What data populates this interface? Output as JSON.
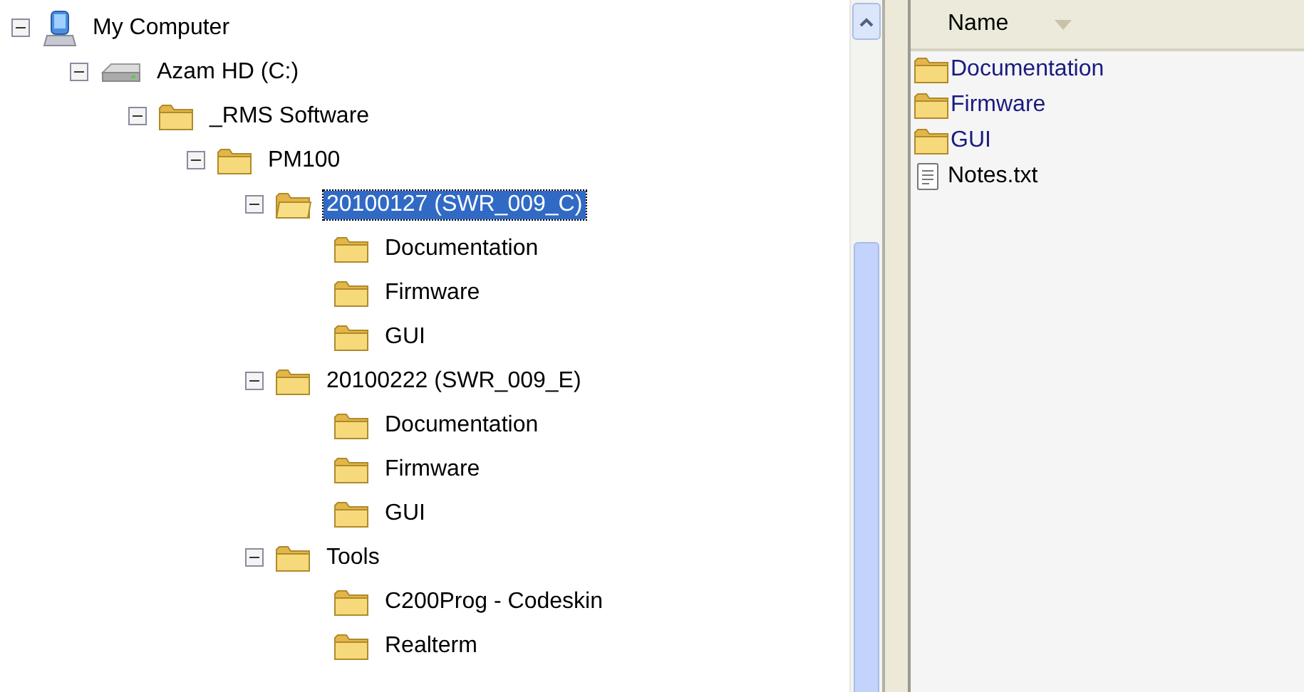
{
  "tree": [
    {
      "label": "My Computer",
      "kind": "computer",
      "selected": false,
      "expanded": true,
      "children": [
        {
          "label": "Azam HD (C:)",
          "kind": "drive",
          "selected": false,
          "expanded": true,
          "children": [
            {
              "label": "_RMS Software",
              "kind": "folder",
              "selected": false,
              "expanded": true,
              "children": [
                {
                  "label": "PM100",
                  "kind": "folder",
                  "selected": false,
                  "expanded": true,
                  "children": [
                    {
                      "label": "20100127 (SWR_009_C)",
                      "kind": "folder",
                      "selected": true,
                      "expanded": true,
                      "children": [
                        {
                          "label": "Documentation",
                          "kind": "folder",
                          "selected": false
                        },
                        {
                          "label": "Firmware",
                          "kind": "folder",
                          "selected": false
                        },
                        {
                          "label": "GUI",
                          "kind": "folder",
                          "selected": false
                        }
                      ]
                    },
                    {
                      "label": "20100222 (SWR_009_E)",
                      "kind": "folder",
                      "selected": false,
                      "expanded": true,
                      "children": [
                        {
                          "label": "Documentation",
                          "kind": "folder",
                          "selected": false
                        },
                        {
                          "label": "Firmware",
                          "kind": "folder",
                          "selected": false
                        },
                        {
                          "label": "GUI",
                          "kind": "folder",
                          "selected": false
                        }
                      ]
                    },
                    {
                      "label": "Tools",
                      "kind": "folder",
                      "selected": false,
                      "expanded": true,
                      "children": [
                        {
                          "label": "C200Prog - Codeskin",
                          "kind": "folder",
                          "selected": false
                        },
                        {
                          "label": "Realterm",
                          "kind": "folder",
                          "selected": false
                        }
                      ]
                    }
                  ]
                }
              ]
            }
          ]
        }
      ]
    }
  ],
  "file_list": {
    "columns": [
      "Name"
    ],
    "items": [
      {
        "name": "Documentation",
        "kind": "folder"
      },
      {
        "name": "Firmware",
        "kind": "folder"
      },
      {
        "name": "GUI",
        "kind": "folder"
      },
      {
        "name": "Notes.txt",
        "kind": "text"
      }
    ]
  }
}
